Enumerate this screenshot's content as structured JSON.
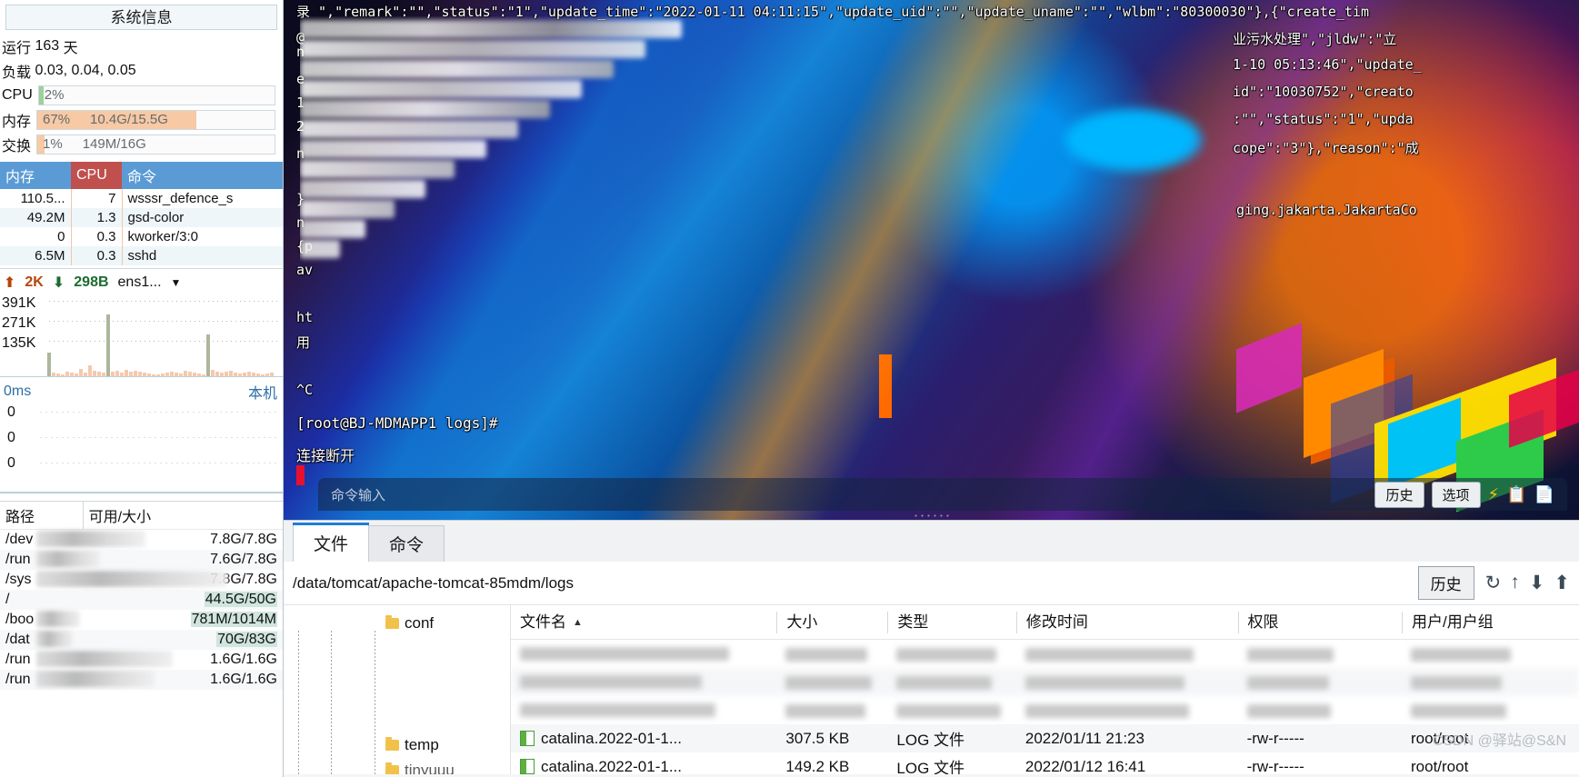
{
  "sidebar": {
    "title": "系统信息",
    "uptime": {
      "label": "运行",
      "value": "163",
      "unit": "天"
    },
    "load": {
      "label": "负载",
      "value": "0.03, 0.04, 0.05"
    },
    "cpu": {
      "label": "CPU",
      "percent": "2%",
      "fill_pct": 2,
      "fill_color": "#9dd09a"
    },
    "memory": {
      "label": "内存",
      "percent": "67%",
      "detail": "10.4G/15.5G",
      "fill_pct": 67,
      "fill_color": "#f7c9a4"
    },
    "swap": {
      "label": "交换",
      "percent": "1%",
      "detail": "149M/16G",
      "fill_pct": 3,
      "fill_color": "#f7c9a4"
    },
    "process_table": {
      "headers": [
        "内存",
        "CPU",
        "命令"
      ],
      "header_colors": {
        "mem": "#5b9bd5",
        "cpu": "#c0504d",
        "cmd": "#5b9bd5"
      },
      "rows": [
        {
          "mem": "110.5...",
          "cpu": "7",
          "cmd": "wsssr_defence_s"
        },
        {
          "mem": "49.2M",
          "cpu": "1.3",
          "cmd": "gsd-color"
        },
        {
          "mem": "0",
          "cpu": "0.3",
          "cmd": "kworker/3:0"
        },
        {
          "mem": "6.5M",
          "cpu": "0.3",
          "cmd": "sshd"
        }
      ]
    },
    "network": {
      "upload": "2K",
      "download": "298B",
      "interface": "ens1...",
      "up_icon": "arrow-up-icon",
      "down_icon": "arrow-down-icon",
      "dropdown_icon": "chevron-down-icon",
      "y_labels": [
        "391K",
        "271K",
        "135K"
      ]
    },
    "latency": {
      "value": "0ms",
      "local_label": "本机",
      "y_labels": [
        "0",
        "0",
        "0"
      ]
    },
    "disk_table": {
      "headers": [
        "路径",
        "可用/大小"
      ],
      "rows": [
        {
          "path": "/dev",
          "redacted": true,
          "value": "7.8G/7.8G",
          "hl": false
        },
        {
          "path": "/run",
          "redacted": true,
          "value": "7.6G/7.8G",
          "hl": false
        },
        {
          "path": "/sys",
          "redacted": true,
          "value": "7.8G/7.8G",
          "hl": false
        },
        {
          "path": "/",
          "redacted": true,
          "value": "44.5G/50G",
          "hl": true
        },
        {
          "path": "/boo",
          "redacted": true,
          "value": "781M/1014M",
          "hl": true
        },
        {
          "path": "/dat",
          "redacted": true,
          "value": "70G/83G",
          "hl": true
        },
        {
          "path": "/run",
          "redacted": true,
          "value": "1.6G/1.6G",
          "hl": false
        },
        {
          "path": "/run",
          "redacted": true,
          "value": "1.6G/1.6G",
          "hl": false
        }
      ]
    }
  },
  "terminal": {
    "lines_top": [
      "录 \",\"remark\":\"\",\"status\":\"1\",\"update_time\":\"2022-01-11 04:11:15\",\"update_uid\":\"\",\"update_uname\":\"\",\"wlbm\":\"80300030\"},{\"create_tim"
    ],
    "lines_right": [
      "业污水处理\",\"jldw\":\"立",
      "1-10 05:13:46\",\"update_",
      "id\":\"10030752\",\"creato",
      ":\"\",\"status\":\"1\",\"upda",
      "cope\":\"3\"},\"reason\":\"成"
    ],
    "line_jakarta": "ging.jakarta.JakartaCo",
    "left_fragments": [
      "@",
      "n",
      "e",
      "1",
      "2",
      "n",
      "}",
      "n",
      "{p",
      "av",
      "ht",
      "用"
    ],
    "interrupt": "^C",
    "prompt": "[root@BJ-MDMAPP1 logs]#",
    "disconnected": "连接断开",
    "cursor_color": "#e8112d",
    "command_input_placeholder": "命令输入",
    "buttons": {
      "history": "历史",
      "options": "选项",
      "bolt_icon": "lightning-icon",
      "copy_icon": "copy-icon",
      "paste_icon": "paste-icon"
    }
  },
  "bottom": {
    "tabs": [
      {
        "label": "文件",
        "active": true
      },
      {
        "label": "命令",
        "active": false
      }
    ],
    "path": "/data/tomcat/apache-tomcat-85mdm/logs",
    "history_button": "历史",
    "tool_icons": [
      "refresh-icon",
      "up-level-icon",
      "download-icon",
      "upload-icon"
    ],
    "tree_nodes": [
      "conf",
      "temp",
      "tinyuuu"
    ],
    "file_headers": {
      "name": "文件名",
      "size": "大小",
      "type": "类型",
      "mtime": "修改时间",
      "perm": "权限",
      "owner": "用户/用户组",
      "sort_indicator": "▲"
    },
    "files": [
      {
        "name": "",
        "size": "",
        "type": "",
        "mtime": "",
        "perm": "",
        "owner": "",
        "redacted": true
      },
      {
        "name": "",
        "size": "",
        "type": "",
        "mtime": "",
        "perm": "",
        "owner": "",
        "redacted": true
      },
      {
        "name": "",
        "size": "",
        "type": "",
        "mtime": "",
        "perm": "",
        "owner": "",
        "redacted": true
      },
      {
        "name": "catalina.2022-01-1...",
        "size": "307.5 KB",
        "type": "LOG 文件",
        "mtime": "2022/01/11 21:23",
        "perm": "-rw-r-----",
        "owner": "root/root",
        "redacted": false
      },
      {
        "name": "catalina.2022-01-1...",
        "size": "149.2 KB",
        "type": "LOG 文件",
        "mtime": "2022/01/12 16:41",
        "perm": "-rw-r-----",
        "owner": "root/root",
        "redacted": false
      }
    ],
    "watermark": "CSDN @驿站@S&N"
  }
}
